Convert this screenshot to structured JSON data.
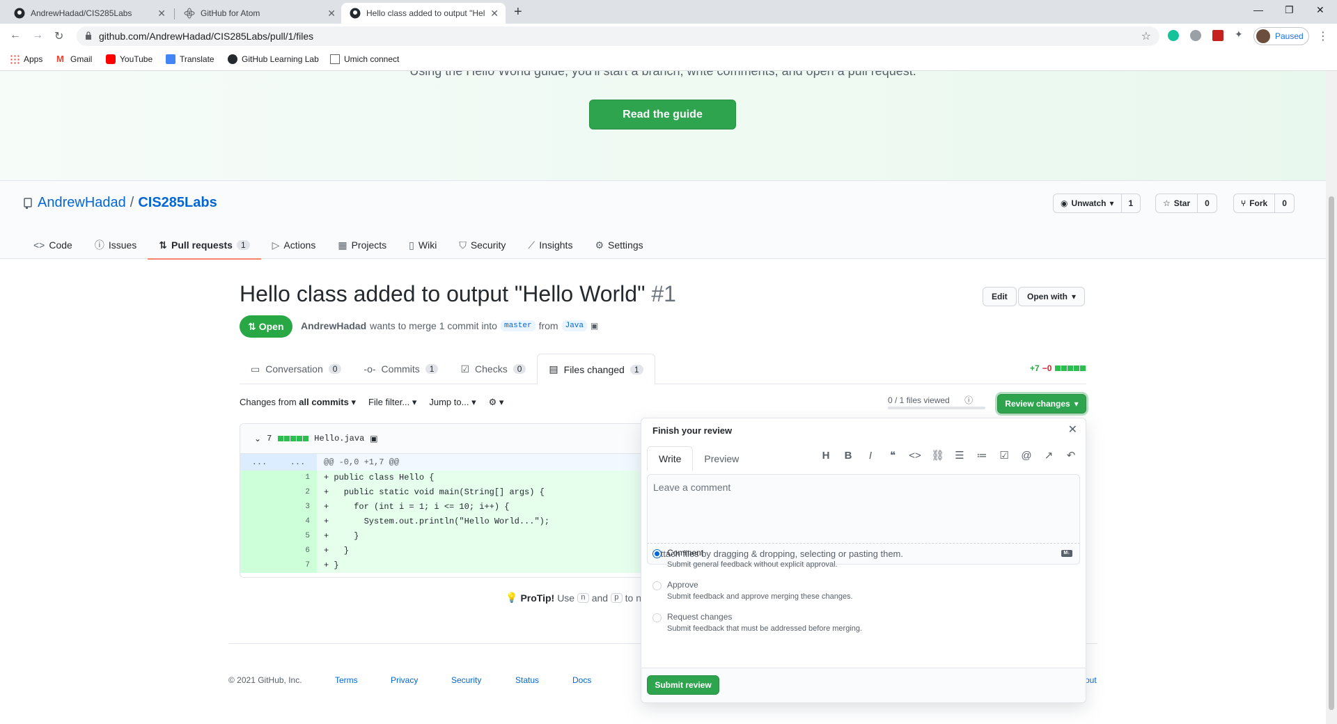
{
  "browser": {
    "tabs": [
      {
        "title": "AndrewHadad/CIS285Labs"
      },
      {
        "title": "GitHub for Atom"
      },
      {
        "title": "Hello class added to output \"Hel"
      }
    ],
    "url": "github.com/AndrewHadad/CIS285Labs/pull/1/files",
    "profile_label": "Paused",
    "bookmarks": [
      "Apps",
      "Gmail",
      "YouTube",
      "Translate",
      "GitHub Learning Lab",
      "Umich connect"
    ]
  },
  "banner": {
    "cut_text": "Using the Hello World guide, you'll start a branch, write comments, and open a pull request.",
    "button_label": "Read the guide"
  },
  "repo": {
    "owner": "AndrewHadad",
    "separator": "/",
    "name": "CIS285Labs",
    "unwatch_label": "Unwatch",
    "watch_count": "1",
    "star_label": "Star",
    "star_count": "0",
    "fork_label": "Fork",
    "fork_count": "0",
    "nav": [
      {
        "label": "Code",
        "icon": "code-icon"
      },
      {
        "label": "Issues",
        "icon": "issue-icon"
      },
      {
        "label": "Pull requests",
        "icon": "pull-request-icon",
        "badge": "1"
      },
      {
        "label": "Actions",
        "icon": "play-icon"
      },
      {
        "label": "Projects",
        "icon": "project-icon"
      },
      {
        "label": "Wiki",
        "icon": "book-icon"
      },
      {
        "label": "Security",
        "icon": "shield-icon"
      },
      {
        "label": "Insights",
        "icon": "graph-icon"
      },
      {
        "label": "Settings",
        "icon": "gear-icon"
      }
    ]
  },
  "pr": {
    "title": "Hello class added to output \"Hello World\"",
    "number": "#1",
    "edit_label": "Edit",
    "open_with_label": "Open with",
    "state": "Open",
    "author": "AndrewHadad",
    "merge_text": "wants to merge 1 commit into",
    "base_branch": "master",
    "from_text": "from",
    "head_branch": "Java",
    "tabs": [
      {
        "label": "Conversation",
        "count": "0"
      },
      {
        "label": "Commits",
        "count": "1"
      },
      {
        "label": "Checks",
        "count": "0"
      },
      {
        "label": "Files changed",
        "count": "1"
      }
    ],
    "additions": "+7",
    "deletions": "−0"
  },
  "files_toolbar": {
    "changes_from": "Changes from",
    "all_commits": "all commits",
    "file_filter": "File filter...",
    "jump_to": "Jump to...",
    "files_viewed": "0 / 1 files viewed",
    "review_button": "Review changes"
  },
  "file": {
    "changes": "7",
    "name": "Hello.java",
    "hunk_header": "@@ -0,0 +1,7 @@",
    "gutter_dots": "...",
    "lines": [
      {
        "n": "1",
        "text": "+ public class Hello {"
      },
      {
        "n": "2",
        "text": "+   public static void main(String[] args) {"
      },
      {
        "n": "3",
        "text": "+     for (int i = 1; i <= 10; i++) {"
      },
      {
        "n": "4",
        "text": "+       System.out.println(\"Hello World...\");"
      },
      {
        "n": "5",
        "text": "+     }"
      },
      {
        "n": "6",
        "text": "+   }"
      },
      {
        "n": "7",
        "text": "+ }"
      }
    ]
  },
  "protip": {
    "label": "ProTip!",
    "text_before": "Use",
    "key1": "n",
    "and": "and",
    "key2": "p",
    "text_after": "to na"
  },
  "footer": {
    "copyright": "© 2021 GitHub, Inc.",
    "links": [
      "Terms",
      "Privacy",
      "Security",
      "Status",
      "Docs"
    ],
    "cut_link": "out"
  },
  "review": {
    "title": "Finish your review",
    "write_tab": "Write",
    "preview_tab": "Preview",
    "placeholder": "Leave a comment",
    "attach_text": "Attach files by dragging & dropping, selecting or pasting them.",
    "md_badge": "M↓",
    "options": [
      {
        "label": "Comment",
        "desc": "Submit general feedback without explicit approval.",
        "selected": true
      },
      {
        "label": "Approve",
        "desc": "Submit feedback and approve merging these changes.",
        "selected": false
      },
      {
        "label": "Request changes",
        "desc": "Submit feedback that must be addressed before merging.",
        "selected": false
      }
    ],
    "submit_label": "Submit review"
  },
  "colors": {
    "primary_green": "#2ea44f",
    "link_blue": "#0366d6",
    "tab_underline": "#f9826c",
    "addition_bg": "#e6ffed"
  }
}
